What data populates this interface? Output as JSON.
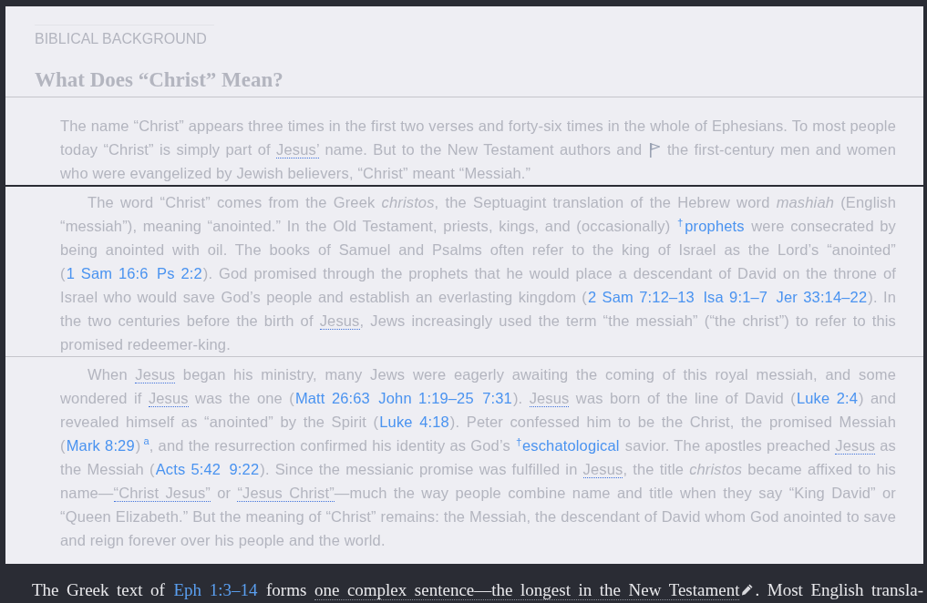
{
  "section_label": "BIBLICAL BACKGROUND",
  "heading": "What Does “Christ” Mean?",
  "paragraphs": [
    {
      "first_line_indent": false,
      "segments": [
        {
          "kind": "text",
          "text": "The name “Christ” appears three times in the first two verses and forty-six times in the whole of Ephesians. To most people today “Christ” is simply part of "
        },
        {
          "kind": "term",
          "text": "Jesus’"
        },
        {
          "kind": "text",
          "text": " name. But to the New Testament authors and "
        },
        {
          "kind": "flag"
        },
        {
          "kind": "text",
          "text": " the first-century men and women who were evangelized by Jewish believers, “Christ” meant “Messiah.”"
        }
      ]
    },
    {
      "first_line_indent": true,
      "segments": [
        {
          "kind": "text",
          "text": "The word “Christ” comes from the Greek *christos*, the Septuagint translation of the Hebrew word *mashiah* (English “messiah”), meaning “anointed.” In the Old Testament, priests, kings, and (occasionally) "
        },
        {
          "kind": "gloss",
          "text": "$^{†}$prophets"
        },
        {
          "kind": "text",
          "text": " were consecrated by being anointed with oil. The books of Samuel and Psalms often refer to the king of Israel as the Lord’s “anointed” ("
        },
        {
          "kind": "refs",
          "items": [
            "1 Sam 16:6",
            "Ps 2:2"
          ]
        },
        {
          "kind": "text",
          "text": "). God promised through the prophets that he would place a descendant of David on the throne of Israel who would save God’s people and establish an everlasting kingdom ("
        },
        {
          "kind": "refs",
          "items": [
            "2 Sam 7:12–13",
            "Isa 9:1–7",
            "Jer 33:14–22"
          ]
        },
        {
          "kind": "text",
          "text": "). In the two centuries before the birth of "
        },
        {
          "kind": "term",
          "text": "Jesus"
        },
        {
          "kind": "text",
          "text": ", Jews increasingly used the term “the messiah” (“the christ”) to refer to this promised redeemer-king."
        }
      ]
    },
    {
      "first_line_indent": true,
      "segments": [
        {
          "kind": "text",
          "text": "When "
        },
        {
          "kind": "term",
          "text": "Jesus"
        },
        {
          "kind": "text",
          "text": " began his ministry, many Jews were eagerly awaiting the coming of this royal messiah, and some wondered if "
        },
        {
          "kind": "term",
          "text": "Jesus"
        },
        {
          "kind": "text",
          "text": " was the one ("
        },
        {
          "kind": "refs",
          "items": [
            "Matt 26:63",
            "John 1:19–25",
            "7:31"
          ]
        },
        {
          "kind": "text",
          "text": "). "
        },
        {
          "kind": "term",
          "text": "Jesus"
        },
        {
          "kind": "text",
          "text": " was born of the line of David ("
        },
        {
          "kind": "refs",
          "items": [
            "Luke 2:4"
          ]
        },
        {
          "kind": "text",
          "text": ") and revealed himself as “anointed” by the Spirit ("
        },
        {
          "kind": "refs",
          "items": [
            "Luke 4:18"
          ]
        },
        {
          "kind": "text",
          "text": "). Peter confessed him to be the Christ, the promised Messiah ("
        },
        {
          "kind": "refs",
          "items": [
            "Mark 8:29"
          ]
        },
        {
          "kind": "text",
          "text": ")"
        },
        {
          "kind": "note",
          "text": "a"
        },
        {
          "kind": "text",
          "text": ", and the resurrection confirmed his identity as God’s "
        },
        {
          "kind": "gloss",
          "text": "$^{†}$eschatological"
        },
        {
          "kind": "text",
          "text": " savior. The apostles preached "
        },
        {
          "kind": "term",
          "text": "Jesus"
        },
        {
          "kind": "text",
          "text": " as the Messiah ("
        },
        {
          "kind": "refs",
          "items": [
            "Acts 5:42",
            "9:22"
          ]
        },
        {
          "kind": "text",
          "text": "). Since the messianic promise was fulfilled in "
        },
        {
          "kind": "term",
          "text": "Jesus"
        },
        {
          "kind": "text",
          "text": ", the title *christos* became affixed to his name—"
        },
        {
          "kind": "term",
          "text": "“Christ Jesus”"
        },
        {
          "kind": "text",
          "text": " or "
        },
        {
          "kind": "term",
          "text": "“Jesus Christ”"
        },
        {
          "kind": "text",
          "text": "—much the way people combine name and title when they say “King David” or “Queen Elizabeth.” But the meaning of “Christ” remains: the Messiah, the descendant of David whom God anointed to save and reign forever over his people and the world."
        }
      ]
    }
  ],
  "footer_text": {
    "segments": [
      {
        "kind": "text",
        "text": "The Greek text of "
      },
      {
        "kind": "refs",
        "items": [
          "Eph 1:3–14"
        ]
      },
      {
        "kind": "text",
        "text": " forms "
      },
      {
        "kind": "term",
        "text": "one complex sentence—the longest in the New Testament"
      },
      {
        "kind": "pencil"
      },
      {
        "kind": "text",
        "text": ". Most English transla-"
      }
    ]
  }
}
